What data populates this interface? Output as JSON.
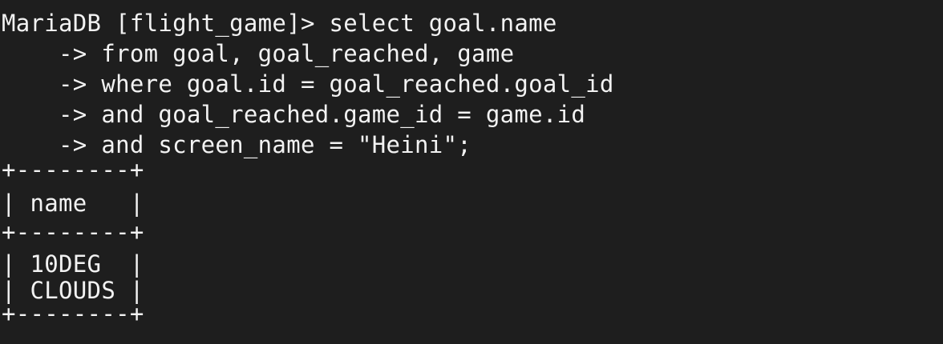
{
  "terminal": {
    "prompt_line": "MariaDB [flight_game]> select goal.name",
    "continuation_lines": [
      "    -> from goal, goal_reached, game",
      "    -> where goal.id = goal_reached.goal_id",
      "    -> and goal_reached.game_id = game.id",
      "    -> and screen_name = \"Heini\";"
    ],
    "result_table": {
      "border": "+--------+",
      "header": "| name   |",
      "rows": [
        "| 10DEG  |",
        "| CLOUDS |"
      ]
    }
  }
}
